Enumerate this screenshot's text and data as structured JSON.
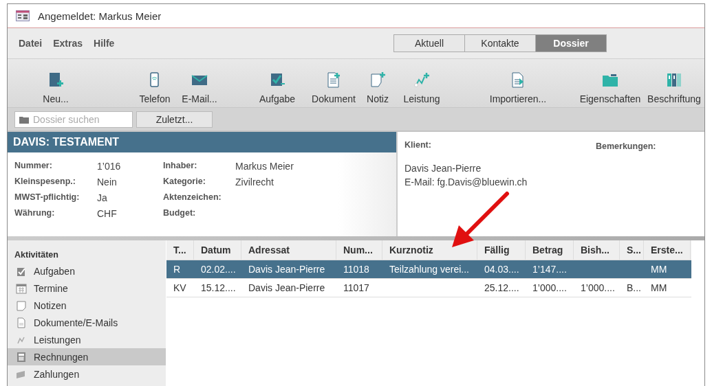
{
  "window": {
    "title": "Angemeldet: Markus Meier"
  },
  "menu": [
    "Datei",
    "Extras",
    "Hilfe"
  ],
  "view_tabs": [
    {
      "label": "Aktuell",
      "selected": false
    },
    {
      "label": "Kontakte",
      "selected": false
    },
    {
      "label": "Dossier",
      "selected": true
    }
  ],
  "toolbar": [
    "Neu...",
    "Telefon",
    "E-Mail...",
    "Aufgabe",
    "Dokument",
    "Notiz",
    "Leistung",
    "Importieren...",
    "Eigenschaften",
    "Beschriftung"
  ],
  "search": {
    "placeholder": "Dossier suchen"
  },
  "recent_button": "Zuletzt...",
  "dossier": {
    "title": "DAVIS: TESTAMENT",
    "fields_left": [
      {
        "label": "Nummer:",
        "value": "1’016"
      },
      {
        "label": "Kleinspesenp.:",
        "value": "Nein"
      },
      {
        "label": "MWST-pflichtig:",
        "value": "Ja"
      },
      {
        "label": "Währung:",
        "value": "CHF"
      }
    ],
    "fields_right": [
      {
        "label": "Inhaber:",
        "value": "Markus Meier"
      },
      {
        "label": "Kategorie:",
        "value": "Zivilrecht"
      },
      {
        "label": "Aktenzeichen:"
      },
      {
        "label": "Budget:"
      }
    ]
  },
  "client": {
    "label": "Klient:",
    "lines": [
      "Davis Jean-Pierre",
      "E-Mail: fg.Davis@bluewin.ch"
    ]
  },
  "remarks": {
    "label": "Bemerkungen:"
  },
  "activities": {
    "title": "Aktivitäten",
    "items": [
      {
        "label": "Aufgaben",
        "selected": false
      },
      {
        "label": "Termine",
        "selected": false
      },
      {
        "label": "Notizen",
        "selected": false
      },
      {
        "label": "Dokumente/E-Mails",
        "selected": false
      },
      {
        "label": "Leistungen",
        "selected": false
      },
      {
        "label": "Rechnungen",
        "selected": true
      },
      {
        "label": "Zahlungen",
        "selected": false
      }
    ]
  },
  "table": {
    "columns": [
      "T...",
      "Datum",
      "Adressat",
      "Num...",
      "Kurznotiz",
      "Fällig",
      "Betrag",
      "Bish...",
      "S...",
      "Erste..."
    ],
    "rows": [
      {
        "selected": true,
        "cells": [
          "R",
          "02.02....",
          "Davis Jean-Pierre",
          "11018",
          "Teilzahlung verei...",
          "04.03....",
          "1’147....",
          null,
          null,
          "MM"
        ]
      },
      {
        "selected": false,
        "cells": [
          "KV",
          "15.12....",
          "Davis Jean-Pierre",
          "11017",
          null,
          "25.12....",
          "1’000....",
          "1’000....",
          "B...",
          "MM"
        ]
      }
    ]
  }
}
